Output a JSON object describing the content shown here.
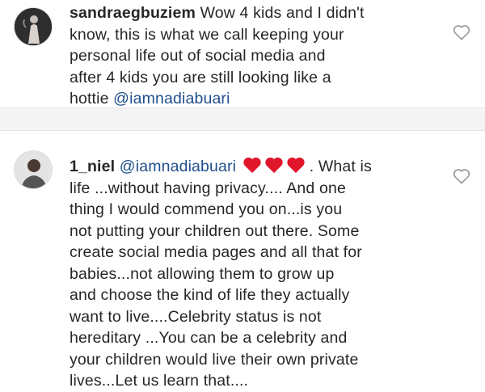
{
  "comments": [
    {
      "username": "sandraegbuziem",
      "lines": [
        "Wow 4 kids and I didn't",
        "know, this is what we call keeping your",
        "personal life out of social media and",
        "after 4 kids you are still looking like a",
        "hottie "
      ],
      "mention_end": "@iamnadiabuari",
      "like_icon": "heart-outline-icon"
    },
    {
      "username": "1_niel",
      "mention": "@iamnadiabuari",
      "first_line_tail": ". What is",
      "lines": [
        "life ...without having privacy.... And one",
        "thing I would commend you on...is you",
        "not putting your children out there. Some",
        "create social media pages and all that for",
        "babies...not allowing them to grow up",
        "and choose the kind of life they actually",
        "want to live....Celebrity status is not",
        "hereditary ...You can be a celebrity and",
        "your children would live their own private",
        "lives...Let us learn that...."
      ],
      "emoji": "red-heart-emoji",
      "emoji_count": 3,
      "like_icon": "heart-outline-icon"
    }
  ],
  "colors": {
    "text": "#262626",
    "mention": "#1f4e8c",
    "heart_emoji": "#e0162b",
    "separator": "#f4f4f4"
  }
}
